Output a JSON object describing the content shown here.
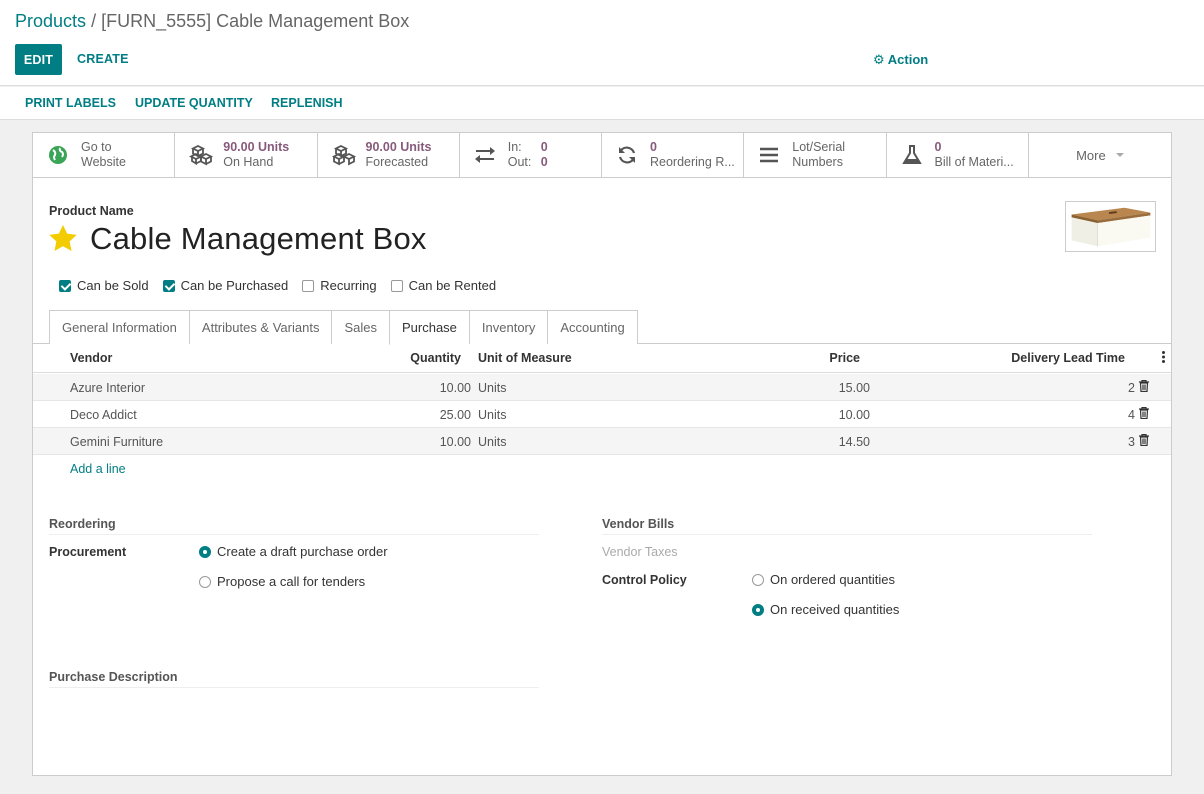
{
  "breadcrumb": {
    "parent": "Products",
    "separator": "/",
    "current": "[FURN_5555] Cable Management Box"
  },
  "control": {
    "edit": "Edit",
    "create": "Create",
    "action": "Action"
  },
  "statusbar": {
    "print_labels": "Print Labels",
    "update_quantity": "Update Quantity",
    "replenish": "Replenish"
  },
  "smart_buttons": {
    "website": {
      "line1": "Go to",
      "line2": "Website"
    },
    "on_hand": {
      "value": "90.00 Units",
      "label": "On Hand"
    },
    "forecasted": {
      "value": "90.00 Units",
      "label": "Forecasted"
    },
    "in_out": {
      "in_label": "In:",
      "in_value": "0",
      "out_label": "Out:",
      "out_value": "0"
    },
    "reordering": {
      "value": "0",
      "label": "Reordering R..."
    },
    "lots": {
      "line1": "Lot/Serial",
      "line2": "Numbers"
    },
    "bom": {
      "value": "0",
      "label": "Bill of Materi..."
    },
    "more": "More"
  },
  "product": {
    "name_label": "Product Name",
    "name": "Cable Management Box",
    "favorite": true,
    "flags": [
      {
        "label": "Can be Sold",
        "checked": true
      },
      {
        "label": "Can be Purchased",
        "checked": true
      },
      {
        "label": "Recurring",
        "checked": false
      },
      {
        "label": "Can be Rented",
        "checked": false
      }
    ]
  },
  "tabs": [
    {
      "label": "General Information",
      "active": false
    },
    {
      "label": "Attributes & Variants",
      "active": false
    },
    {
      "label": "Sales",
      "active": false
    },
    {
      "label": "Purchase",
      "active": true
    },
    {
      "label": "Inventory",
      "active": false
    },
    {
      "label": "Accounting",
      "active": false
    }
  ],
  "vendors": {
    "columns": {
      "vendor": "Vendor",
      "quantity": "Quantity",
      "uom": "Unit of Measure",
      "price": "Price",
      "lead_time": "Delivery Lead Time"
    },
    "rows": [
      {
        "vendor": "Azure Interior",
        "quantity": "10.00",
        "uom": "Units",
        "price": "15.00",
        "lead_time": "2"
      },
      {
        "vendor": "Deco Addict",
        "quantity": "25.00",
        "uom": "Units",
        "price": "10.00",
        "lead_time": "4"
      },
      {
        "vendor": "Gemini Furniture",
        "quantity": "10.00",
        "uom": "Units",
        "price": "14.50",
        "lead_time": "3"
      }
    ],
    "add_line": "Add a line"
  },
  "reordering": {
    "title": "Reordering",
    "procurement_label": "Procurement",
    "options": [
      {
        "label": "Create a draft purchase order",
        "selected": true
      },
      {
        "label": "Propose a call for tenders",
        "selected": false
      }
    ]
  },
  "vendor_bills": {
    "title": "Vendor Bills",
    "taxes_label": "Vendor Taxes",
    "control_policy_label": "Control Policy",
    "options": [
      {
        "label": "On ordered quantities",
        "selected": false
      },
      {
        "label": "On received quantities",
        "selected": true
      }
    ]
  },
  "purchase_description": {
    "title": "Purchase Description"
  },
  "colors": {
    "primary": "#017e84",
    "smart_value": "#875a7b",
    "star": "#f3cc00"
  }
}
